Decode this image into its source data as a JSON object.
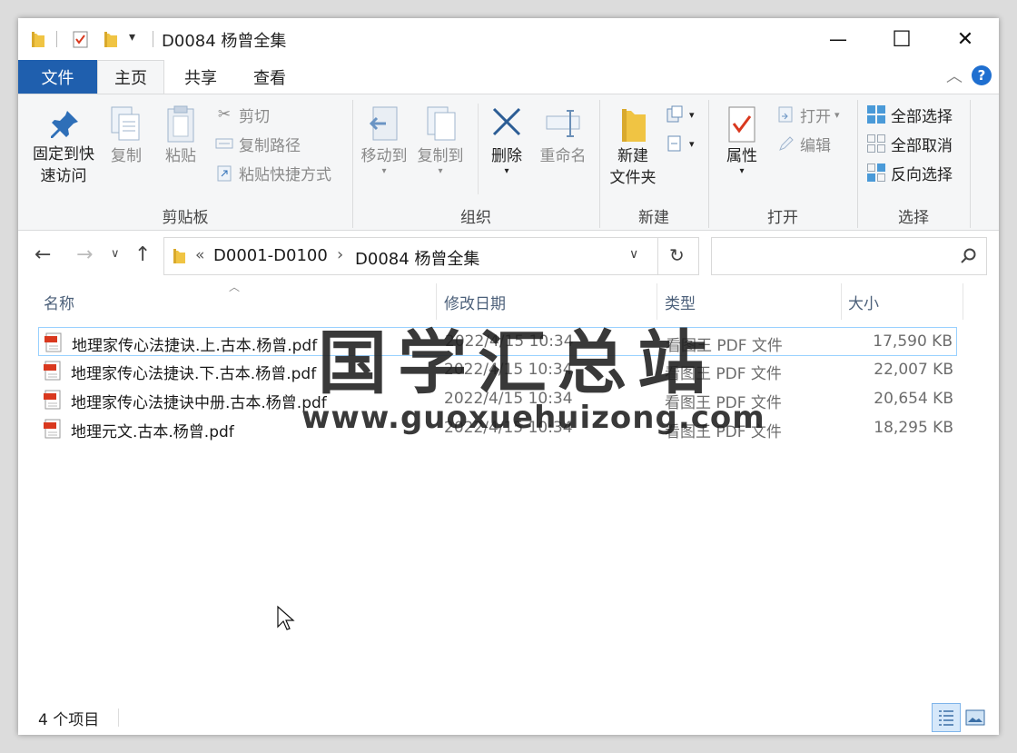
{
  "window": {
    "title": "D0084 杨曾全集",
    "controls": {
      "minimize": "—",
      "maximize": "☐",
      "close": "✕"
    }
  },
  "tabs": {
    "file": "文件",
    "home": "主页",
    "share": "共享",
    "view": "查看"
  },
  "help_label": "?",
  "ribbon": {
    "clipboard": {
      "group": "剪贴板",
      "pin_line1": "固定到快",
      "pin_line2": "速访问",
      "copy": "复制",
      "paste": "粘贴",
      "cut": "剪切",
      "copy_path": "复制路径",
      "paste_shortcut": "粘贴快捷方式"
    },
    "organize": {
      "group": "组织",
      "move_to": "移动到",
      "copy_to": "复制到",
      "delete": "删除",
      "rename": "重命名"
    },
    "new": {
      "group": "新建",
      "new_folder_line1": "新建",
      "new_folder_line2": "文件夹"
    },
    "open": {
      "group": "打开",
      "properties": "属性",
      "open": "打开",
      "edit": "编辑"
    },
    "select": {
      "group": "选择",
      "select_all": "全部选择",
      "select_none": "全部取消",
      "invert": "反向选择"
    }
  },
  "address": {
    "overflow": "«",
    "crumb1": "D0001-D0100",
    "sep": "›",
    "crumb2": "D0084 杨曾全集"
  },
  "columns": {
    "name": "名称",
    "date": "修改日期",
    "type": "类型",
    "size": "大小"
  },
  "files": [
    {
      "name": "地理家传心法捷诀.上.古本.杨曾.pdf",
      "date": "2022/4/15 10:34",
      "type": "看图王 PDF 文件",
      "size": "17,590 KB"
    },
    {
      "name": "地理家传心法捷诀.下.古本.杨曾.pdf",
      "date": "2022/4/15 10:34",
      "type": "看图王 PDF 文件",
      "size": "22,007 KB"
    },
    {
      "name": "地理家传心法捷诀中册.古本.杨曾.pdf",
      "date": "2022/4/15 10:34",
      "type": "看图王 PDF 文件",
      "size": "20,654 KB"
    },
    {
      "name": "地理元文.古本.杨曾.pdf",
      "date": "2022/4/15 10:34",
      "type": "看图王 PDF 文件",
      "size": "18,295 KB"
    }
  ],
  "watermark": {
    "cn": "国学汇总站",
    "url": "www.guoxuehuizong.com"
  },
  "status": {
    "count": "4 个项目"
  },
  "colors": {
    "accent": "#1f5fae",
    "selection": "#99d1ff",
    "folder": "#f0c443"
  }
}
